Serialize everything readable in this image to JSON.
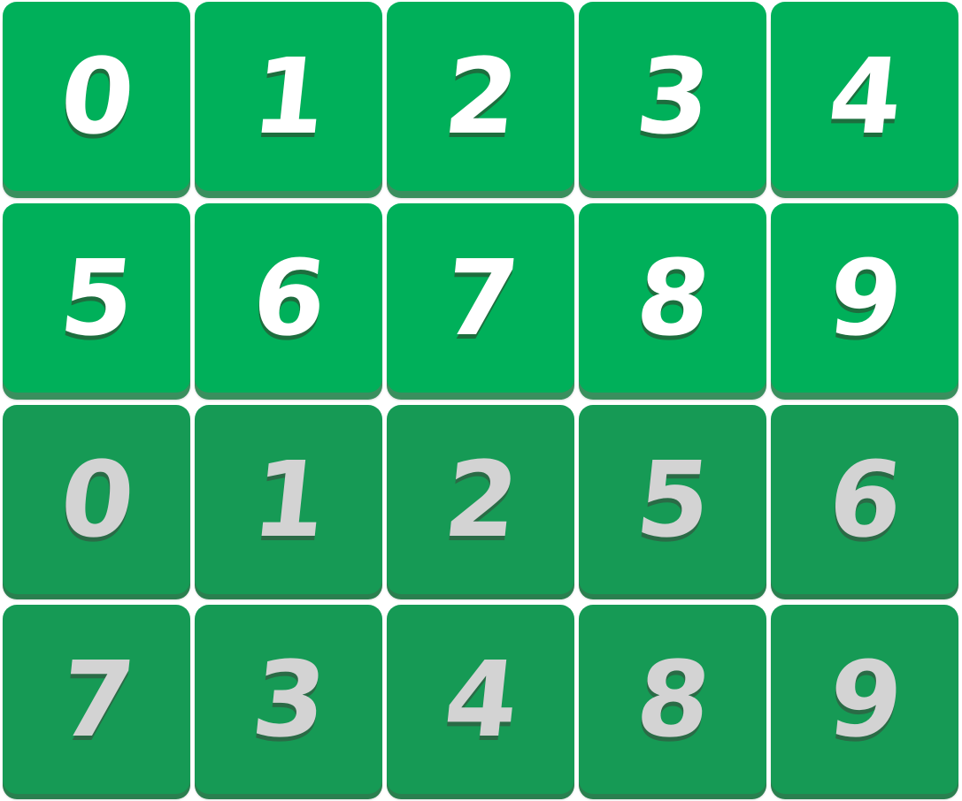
{
  "board": {
    "rows": [
      {
        "state": "active",
        "tiles": [
          {
            "digit": "0"
          },
          {
            "digit": "1"
          },
          {
            "digit": "2"
          },
          {
            "digit": "3"
          },
          {
            "digit": "4"
          }
        ]
      },
      {
        "state": "active",
        "tiles": [
          {
            "digit": "5"
          },
          {
            "digit": "6"
          },
          {
            "digit": "7"
          },
          {
            "digit": "8"
          },
          {
            "digit": "9"
          }
        ]
      },
      {
        "state": "dim",
        "tiles": [
          {
            "digit": "0"
          },
          {
            "digit": "1"
          },
          {
            "digit": "2"
          },
          {
            "digit": "5"
          },
          {
            "digit": "6"
          }
        ]
      },
      {
        "state": "dim",
        "tiles": [
          {
            "digit": "7"
          },
          {
            "digit": "3"
          },
          {
            "digit": "4"
          },
          {
            "digit": "8"
          },
          {
            "digit": "9"
          }
        ]
      }
    ]
  },
  "colors": {
    "active_tile": "#00b05a",
    "dim_tile": "#169a55",
    "active_digit": "#ffffff",
    "dim_digit": "#d3d3d3"
  }
}
